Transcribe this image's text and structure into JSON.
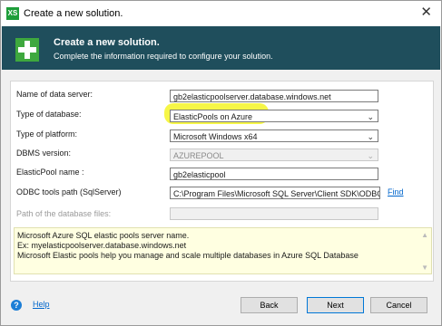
{
  "window": {
    "title": "Create a new solution.",
    "app_icon": "XS",
    "close_glyph": "✕"
  },
  "banner": {
    "title": "Create a new solution.",
    "subtitle": "Complete the information required to configure your solution."
  },
  "form": {
    "server_label": "Name of data server:",
    "server_value": "gb2elasticpoolserver.database.windows.net",
    "db_type_label": "Type of database:",
    "db_type_value": "ElasticPools on Azure",
    "platform_label": "Type of platform:",
    "platform_value": "Microsoft Windows x64",
    "dbms_label": "DBMS version:",
    "dbms_value": "AZUREPOOL",
    "pool_label": "ElasticPool name :",
    "pool_value": "gb2elasticpool",
    "odbc_label": "ODBC tools path (SqlServer)",
    "odbc_value": "C:\\Program Files\\Microsoft SQL Server\\Client SDK\\ODBC\\",
    "find_label": "Find",
    "dbfiles_label": "Path of the database files:",
    "dbfiles_value": ""
  },
  "info": {
    "line1": "Microsoft Azure SQL elastic pools server name.",
    "line2": "Ex: myelasticpoolserver.database.windows.net",
    "line3": "Microsoft Elastic pools help you manage and scale multiple databases in Azure SQL Database"
  },
  "footer": {
    "help_label": "Help",
    "back_label": "Back",
    "next_label": "Next",
    "cancel_label": "Cancel"
  },
  "colors": {
    "banner": "#1f4e5c",
    "highlight": "#f5f533",
    "info_bg": "#ffffe1",
    "link": "#0066cc"
  },
  "icons": {
    "app": "app-logo-icon",
    "banner": "add-solution-icon",
    "help": "help-icon",
    "chevron": "chevron-down-icon"
  }
}
